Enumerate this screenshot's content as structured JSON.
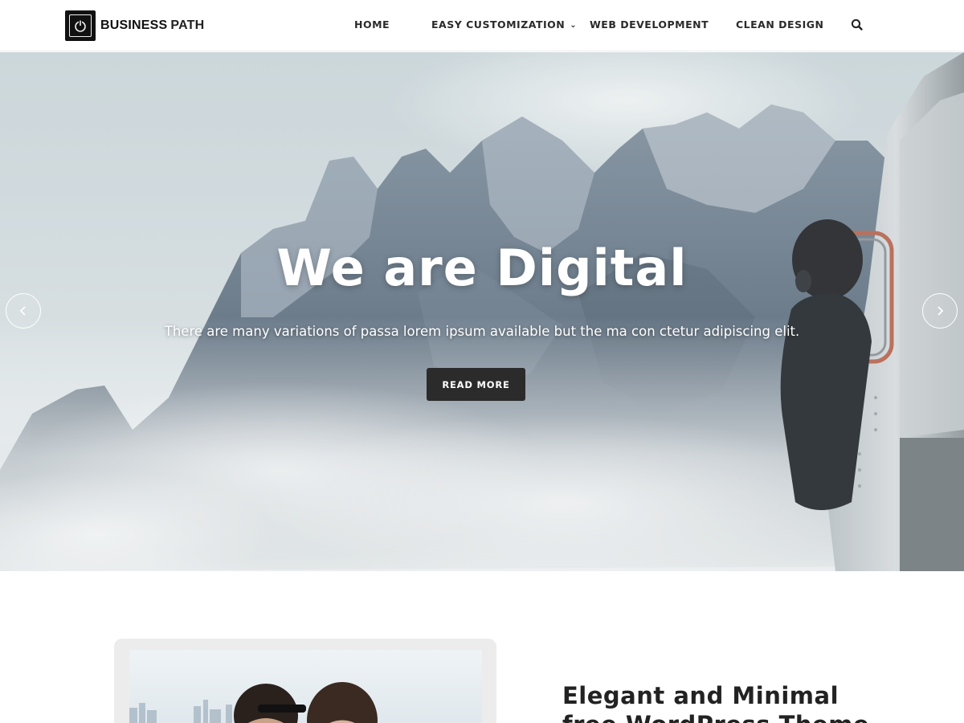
{
  "brand": {
    "name_bold": "BUSINESS",
    "name_rest": "PATH"
  },
  "nav": {
    "items": [
      {
        "label": "HOME"
      },
      {
        "label": "EASY CUSTOMIZATION",
        "has_dropdown": true
      },
      {
        "label": "WEB DEVELOPMENT"
      },
      {
        "label": "CLEAN DESIGN"
      }
    ],
    "search_icon": "search-icon"
  },
  "hero": {
    "title": "We are Digital",
    "subtitle": "There are many variations of passa lorem ipsum available but the ma con ctetur adipiscing elit.",
    "button_label": "READ MORE",
    "prev_icon": "chevron-left-icon",
    "next_icon": "chevron-right-icon"
  },
  "feature": {
    "title": "Elegant and Minimal free WordPress Theme"
  },
  "colors": {
    "button_dark": "#2b2b2b",
    "text_dark": "#222222",
    "header_bg": "#ffffff"
  }
}
